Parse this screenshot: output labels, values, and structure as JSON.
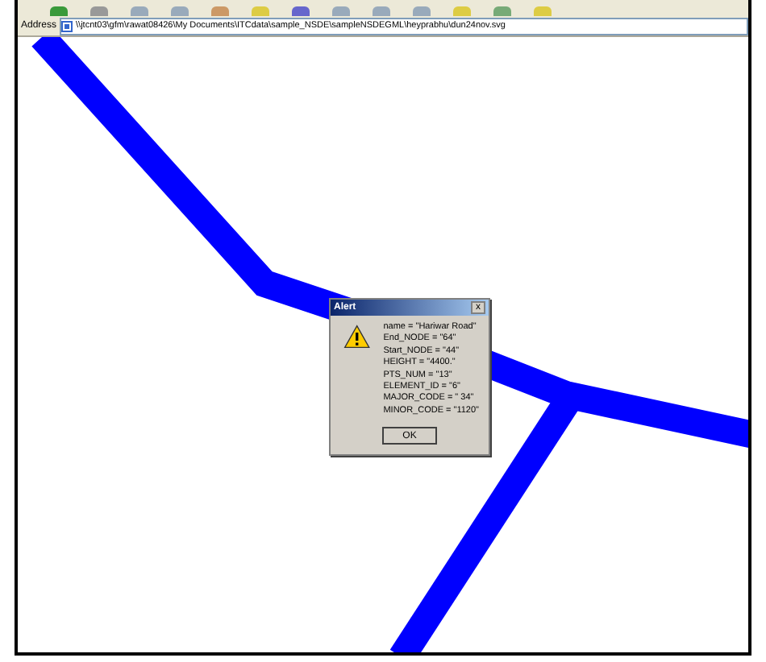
{
  "address_bar": {
    "label": "Address",
    "value": "\\\\jtcnt03\\gfm\\rawat08426\\My Documents\\ITCdata\\sample_NSDE\\sampleNSDEGML\\heyprabhu\\dun24nov.svg"
  },
  "alert": {
    "title": "Alert",
    "close": "x",
    "lines": [
      "name = \"Hariwar Road\"",
      "End_NODE = \"64\"",
      "Start_NODE = \"44\"",
      "HEIGHT = \"4400.\"",
      "PTS_NUM = \"13\"",
      "ELEMENT_ID = \"6\"",
      "MAJOR_CODE = \" 34\"",
      "MINOR_CODE = \"1120\""
    ],
    "button": "OK"
  }
}
